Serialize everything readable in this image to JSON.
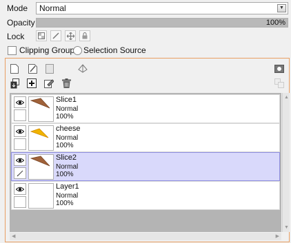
{
  "properties": {
    "mode_label": "Mode",
    "mode_value": "Normal",
    "opacity_label": "Opacity",
    "opacity_value": "100%",
    "opacity_fraction": 1.0,
    "lock_label": "Lock",
    "lock_icons": [
      "lock-transparency-icon",
      "lock-paint-icon",
      "lock-move-icon",
      "lock-all-icon"
    ],
    "clipping_group_label": "Clipping Group",
    "selection_source_label": "Selection Source",
    "clipping_group_checked": false,
    "selection_source_selected": false
  },
  "toolbar": {
    "row1_icons": [
      "new-layer-icon",
      "new-vector-layer-icon",
      "new-folder-icon",
      "layer-settings-icon"
    ],
    "row2_icons": [
      "merge-down-icon",
      "add-mask-icon",
      "clear-layer-icon",
      "trash-icon"
    ],
    "right_icons": [
      "quick-mask-icon",
      "multi-select-icon"
    ]
  },
  "layers": [
    {
      "name": "Slice1",
      "mode": "Normal",
      "opacity": "100%",
      "selected": false,
      "thumb": "slice",
      "editing": false
    },
    {
      "name": "cheese",
      "mode": "Normal",
      "opacity": "100%",
      "selected": false,
      "thumb": "cheese",
      "editing": false
    },
    {
      "name": "Slice2",
      "mode": "Normal",
      "opacity": "100%",
      "selected": true,
      "thumb": "slice",
      "editing": true
    },
    {
      "name": "Layer1",
      "mode": "Normal",
      "opacity": "100%",
      "selected": false,
      "thumb": "blank",
      "editing": false
    }
  ],
  "colors": {
    "selected_row": "#d9d9fb",
    "panel_border": "#e89e62",
    "slice_brown": "#a0623a",
    "cheese_yellow": "#f0b400"
  }
}
